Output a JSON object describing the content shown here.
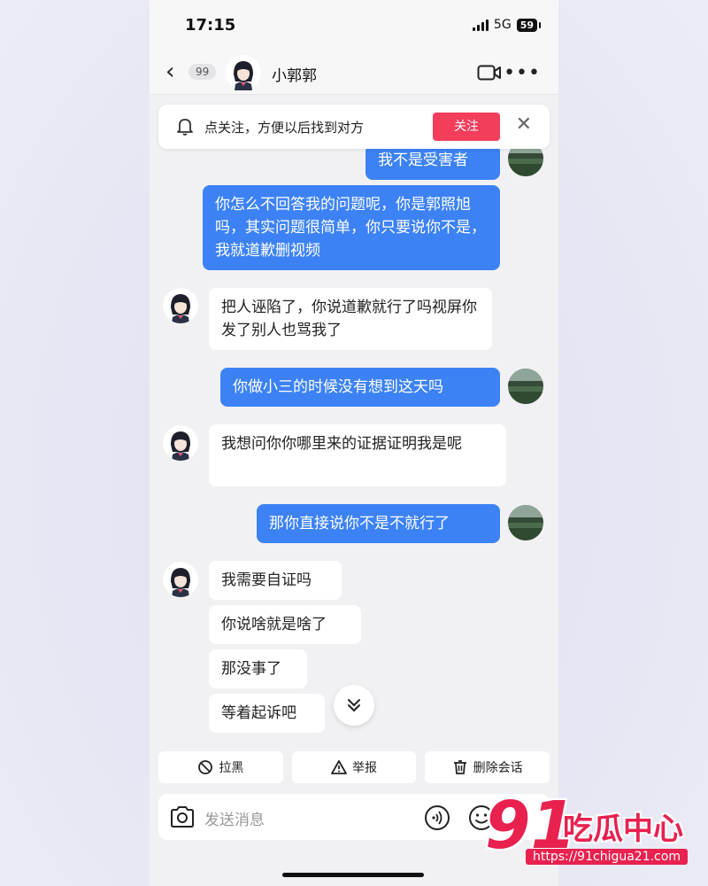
{
  "status": {
    "time": "17:15",
    "network": "5G",
    "battery": "59"
  },
  "header": {
    "unread_count": "99",
    "contact_name": "小郭郭"
  },
  "follow_bar": {
    "text": "点关注，方便以后找到对方",
    "button": "关注"
  },
  "messages": [
    {
      "dir": "out",
      "text": "我不是受害者"
    },
    {
      "dir": "out",
      "text": "你怎么不回答我的问题呢，你是郭照旭吗，其实问题很简单，你只要说你不是，我就道歉删视频"
    },
    {
      "dir": "in",
      "text": "把人诬陷了，你说道歉就行了吗视屏你发了别人也骂我了"
    },
    {
      "dir": "out",
      "text": "你做小三的时候没有想到这天吗"
    },
    {
      "dir": "in",
      "text": "我想问你你哪里来的证据证明我是呢"
    },
    {
      "dir": "out",
      "text": "那你直接说你不是不就行了"
    },
    {
      "dir": "in",
      "text": "我需要自证吗"
    },
    {
      "dir": "in",
      "text": "你说啥就是啥了"
    },
    {
      "dir": "in",
      "text": "那没事了"
    },
    {
      "dir": "in",
      "text": "等着起诉吧"
    }
  ],
  "actions": {
    "block": "拉黑",
    "report": "举报",
    "delete": "删除会话"
  },
  "input": {
    "placeholder": "发送消息"
  },
  "watermark": {
    "number": "91",
    "name": "吃瓜中心",
    "url": "https://91chigua21.com"
  },
  "colors": {
    "outgoing_bubble": "#3d82f5",
    "follow_button": "#f23d5b",
    "watermark": "#e8214f"
  }
}
